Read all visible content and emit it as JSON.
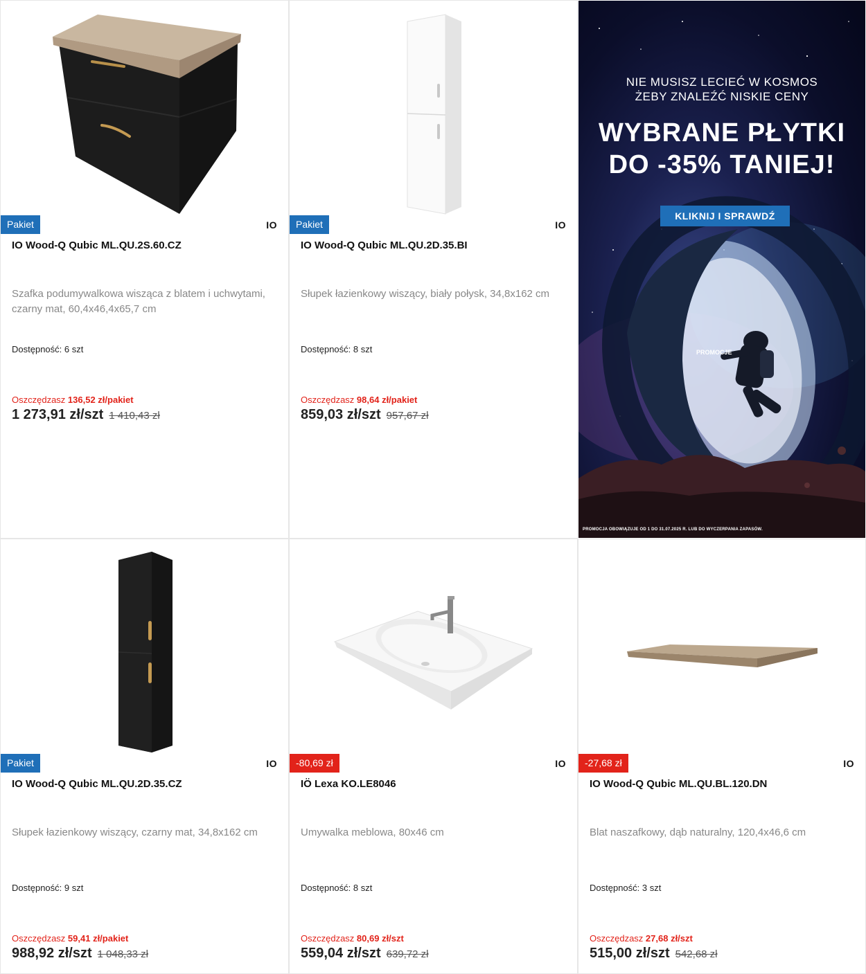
{
  "banner": {
    "line1": "NIE MUSISZ LECIEĆ W KOSMOS",
    "line2": "ŻEBY ZNALEŹĆ NISKIE CENY",
    "headline1": "WYBRANE PŁYTKI",
    "headline2": "DO -35% TANIEJ!",
    "cta": "KLIKNIJ I SPRAWDŹ",
    "promo_label": "PROMOCJE",
    "footnote": "PROMOCJA OBOWIĄZUJE OD 1 DO 31.07.2025 R. LUB DO WYCZERPANIA ZAPASÓW."
  },
  "products": [
    {
      "image": "black-vanity-cabinet-with-wood-top",
      "badge": "Pakiet",
      "badge_color": "#1f6fb8",
      "brand": "IO",
      "title": "IO Wood-Q Qubic ML.QU.2S.60.CZ",
      "description": "Szafka podumywalkowa wisząca z blatem i uchwytami, czarny mat, 60,4x46,4x65,7 cm",
      "availability": "Dostępność: 6 szt",
      "save_label": "Oszczędzasz ",
      "save_value": "136,52 zł/pakiet",
      "price": "1 273,91 zł/szt",
      "old_price": "1 410,43 zł"
    },
    {
      "image": "white-tall-cabinet",
      "badge": "Pakiet",
      "badge_color": "#1f6fb8",
      "brand": "IO",
      "title": "IO Wood-Q Qubic ML.QU.2D.35.BI",
      "description": "Słupek łazienkowy wiszący, biały połysk, 34,8x162 cm",
      "availability": "Dostępność: 8 szt",
      "save_label": "Oszczędzasz ",
      "save_value": "98,64 zł/pakiet",
      "price": "859,03 zł/szt",
      "old_price": "957,67 zł"
    },
    {
      "image": "black-tall-cabinet",
      "badge": "Pakiet",
      "badge_color": "#1f6fb8",
      "brand": "IO",
      "title": "IO Wood-Q Qubic ML.QU.2D.35.CZ",
      "description": "Słupek łazienkowy wiszący, czarny mat, 34,8x162 cm",
      "availability": "Dostępność: 9 szt",
      "save_label": "Oszczędzasz ",
      "save_value": "59,41 zł/pakiet",
      "price": "988,92 zł/szt",
      "old_price": "1 048,33 zł"
    },
    {
      "image": "white-furniture-washbasin-with-faucet",
      "badge": "-80,69 zł",
      "badge_color": "#e2231a",
      "brand": "IO",
      "title": "IÖ Lexa KO.LE8046",
      "description": "Umywalka meblowa, 80x46 cm",
      "availability": "Dostępność: 8 szt",
      "save_label": "Oszczędzasz ",
      "save_value": "80,69 zł/szt",
      "price": "559,04 zł/szt",
      "old_price": "639,72 zł"
    },
    {
      "image": "oak-countertop",
      "badge": "-27,68 zł",
      "badge_color": "#e2231a",
      "brand": "IO",
      "title": "IO Wood-Q Qubic ML.QU.BL.120.DN",
      "description": "Blat naszafkowy, dąb naturalny, 120,4x46,6 cm",
      "availability": "Dostępność: 3 szt",
      "save_label": "Oszczędzasz ",
      "save_value": "27,68 zł/szt",
      "price": "515,00 zł/szt",
      "old_price": "542,68 zł"
    }
  ]
}
